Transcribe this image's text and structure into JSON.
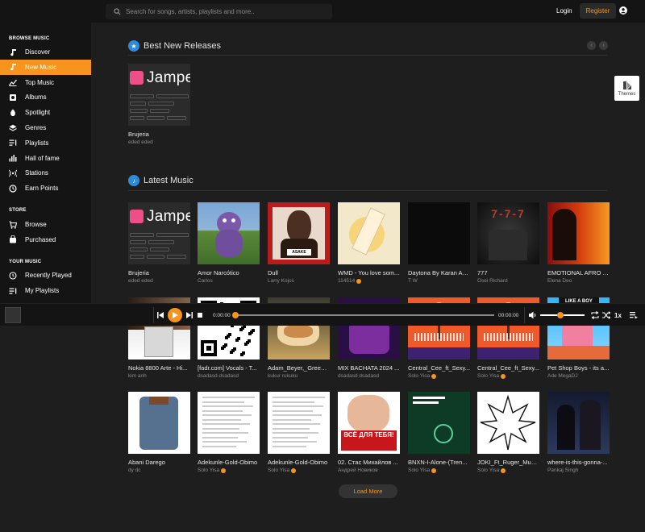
{
  "header": {
    "search_placeholder": "Search for songs, artists, playlists and more..",
    "login": "Login",
    "register": "Register"
  },
  "sidebar": {
    "browse_label": "BROWSE MUSIC",
    "browse": [
      {
        "label": "Discover",
        "icon": "music-note-icon"
      },
      {
        "label": "New Music",
        "icon": "music-note-icon",
        "active": true
      },
      {
        "label": "Top Music",
        "icon": "chart-icon"
      },
      {
        "label": "Albums",
        "icon": "album-icon"
      },
      {
        "label": "Spotlight",
        "icon": "spotlight-icon"
      },
      {
        "label": "Genres",
        "icon": "genre-icon"
      },
      {
        "label": "Playlists",
        "icon": "playlist-icon"
      },
      {
        "label": "Hall of fame",
        "icon": "hall-of-fame-icon"
      },
      {
        "label": "Stations",
        "icon": "radio-icon"
      },
      {
        "label": "Earn Points",
        "icon": "points-icon"
      }
    ],
    "store_label": "STORE",
    "store": [
      {
        "label": "Browse",
        "icon": "cart-icon"
      },
      {
        "label": "Purchased",
        "icon": "bag-icon"
      }
    ],
    "your_label": "YOUR MUSIC",
    "your": [
      {
        "label": "Recently Played",
        "icon": "history-icon"
      },
      {
        "label": "My Playlists",
        "icon": "playlist-icon"
      }
    ]
  },
  "best": {
    "title": "Best New Releases",
    "cards": [
      {
        "title": "Brujeria",
        "sub": "eded eded",
        "logo": "Jampea"
      }
    ]
  },
  "latest": {
    "title": "Latest Music",
    "cards": [
      {
        "title": "Brujeria",
        "sub": "eded eded"
      },
      {
        "title": "Amor Narcótico",
        "sub": "Carlos"
      },
      {
        "title": "Dull",
        "sub": "Larry Kojos",
        "art_text": "ASAKE"
      },
      {
        "title": "WMD - You love som...",
        "sub": "114514",
        "verified": true
      },
      {
        "title": "Daytona By Karan Au...",
        "sub": "T W"
      },
      {
        "title": "777",
        "sub": "Osei Richard",
        "art_text": "7-7-7"
      },
      {
        "title": "EMOTIONAL AFRO T...",
        "sub": "Elena Deo"
      },
      {
        "title": "Nokia 8800 Arte - Hi...",
        "sub": "kim anh"
      },
      {
        "title": "[fadr.com] Vocals - T...",
        "sub": "dsadasd dsadasd"
      },
      {
        "title": "Adam_Beyer,_Green_...",
        "sub": "kukur rukuku"
      },
      {
        "title": "MIX BACHATA 2024 ...",
        "sub": "dsadasd dsadasd"
      },
      {
        "title": "Central_Cee_ft_Sexy...",
        "sub": "Solo Yisa",
        "verified": true
      },
      {
        "title": "Central_Cee_ft_Sexy...",
        "sub": "Solo Yisa",
        "verified": true
      },
      {
        "title": "Pet Shop Boys - its a...",
        "sub": "Ade MegaDJ",
        "art_text": "LIKE A BOY"
      },
      {
        "title": "Abani Darego",
        "sub": "dy dc"
      },
      {
        "title": "Adekunle-Gold-Obimo",
        "sub": "Solo Yisa",
        "verified": true
      },
      {
        "title": "Adekunle-Gold-Obimo",
        "sub": "Solo Yisa",
        "verified": true
      },
      {
        "title": "02. Стас Михайлов ...",
        "sub": "Андрей Новиков",
        "art_text": "ВСЁ ДЛЯ ТЕБЯ!"
      },
      {
        "title": "BNXN-I-Alone-(Tren...",
        "sub": "Solo Yisa",
        "verified": true
      },
      {
        "title": "JOKI_Ft_Ruger_Mugi...",
        "sub": "Solo Yisa",
        "verified": true
      },
      {
        "title": "where-is-this-gonna-...",
        "sub": "Pankaj Singh"
      }
    ]
  },
  "player": {
    "time_current": "0:00:00",
    "time_total": "00:00:00",
    "progress": 0,
    "volume": 0.45,
    "rate": "1x"
  },
  "themes_label": "Themes",
  "load_more": "Load More",
  "colors": {
    "accent": "#f7941d",
    "bg": "#1e1e1e",
    "sidebar": "#141414",
    "badge": "#2e8bd8"
  }
}
